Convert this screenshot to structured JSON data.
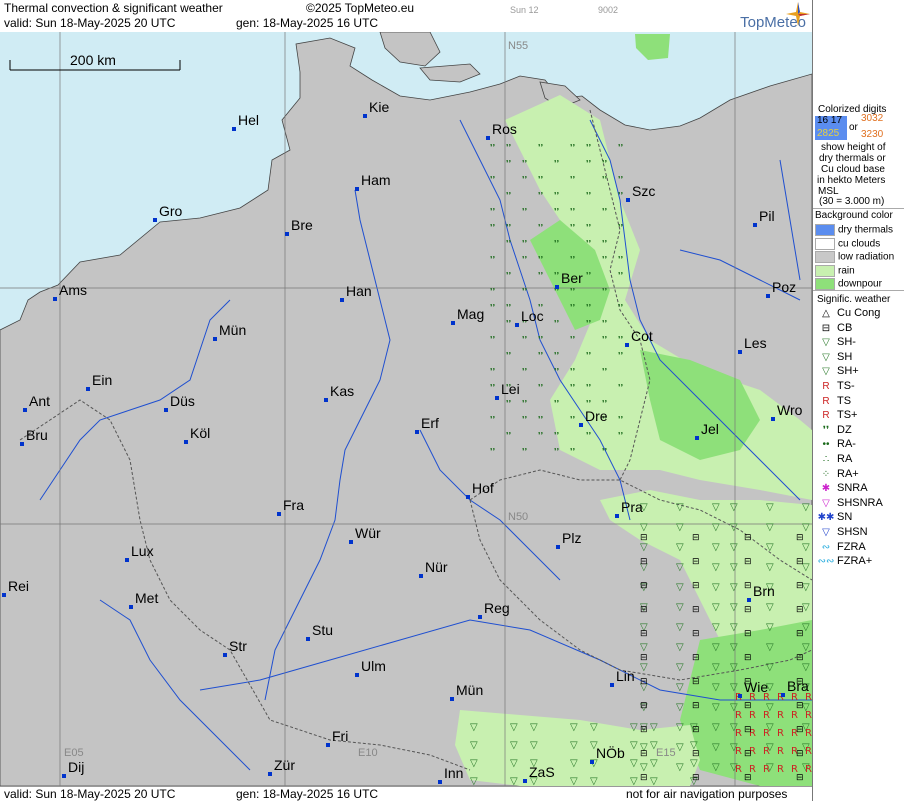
{
  "header": {
    "title": "Thermal convection & significant weather",
    "copyright": "©2025 TopMeteo.eu",
    "tag1": "Sun 12",
    "tag2": "9002",
    "valid": "valid:  Sun  18-May-2025  20 UTC",
    "gen": "gen: 18-May-2025 16 UTC",
    "logo": "TopMeteo"
  },
  "footer": {
    "valid": "valid:  Sun  18-May-2025  20 UTC",
    "gen": "gen: 18-May-2025 16 UTC",
    "note": "not for air navigation purposes"
  },
  "map": {
    "scale_label": "200 km",
    "coord_labels": [
      "N55",
      "N50",
      "E05",
      "E10",
      "E15"
    ],
    "cities": [
      "Kie",
      "Hel",
      "Ros",
      "Ham",
      "Gro",
      "Szc",
      "Bre",
      "Pil",
      "Ber",
      "Ams",
      "Han",
      "Poz",
      "Mag",
      "Loc",
      "Mün",
      "Cot",
      "Les",
      "Ein",
      "Kas",
      "Lei",
      "Ant",
      "Düs",
      "Wro",
      "Bru",
      "Köl",
      "Erf",
      "Dre",
      "Jel",
      "Hof",
      "Fra",
      "Pra",
      "Wür",
      "Lux",
      "Plz",
      "Nür",
      "Rei",
      "Met",
      "Brn",
      "Reg",
      "Stu",
      "Str",
      "Lin",
      "Ulm",
      "Wie",
      "Bra",
      "Mün",
      "Fri",
      "NÖb",
      "Dij",
      "Zür",
      "Inn",
      "ZaS"
    ]
  },
  "legend": {
    "digits_title": "Colorized digits",
    "d1": "16",
    "d2": "17",
    "d3": "30",
    "d4": "32",
    "or": "or",
    "d5": "28",
    "d6": "25",
    "d7": "32",
    "d8": "30",
    "desc": [
      "show height of",
      "dry thermals or",
      "Cu cloud base",
      "in hekto Meters",
      "MSL",
      "(30 = 3.000 m)"
    ],
    "bg_title": "Background color",
    "bg_items": [
      {
        "label": "dry thermals",
        "color": "#5b8def"
      },
      {
        "label": "cu clouds",
        "color": "#ffffff"
      },
      {
        "label": "low radiation",
        "color": "#c8c8c8"
      },
      {
        "label": "rain",
        "color": "#c8f0b0"
      },
      {
        "label": "downpour",
        "color": "#8ee07a"
      }
    ],
    "wx_title": "Signific. weather",
    "wx_items": [
      {
        "label": "Cu Cong",
        "icon": "cu-cong-icon",
        "sym": "△",
        "color": "#000"
      },
      {
        "label": "CB",
        "icon": "cb-icon",
        "sym": "⊟",
        "color": "#000"
      },
      {
        "label": "SH-",
        "icon": "shower-light-icon",
        "sym": "▽",
        "color": "#2a7a2a"
      },
      {
        "label": "SH",
        "icon": "shower-icon",
        "sym": "▽",
        "color": "#2a7a2a"
      },
      {
        "label": "SH+",
        "icon": "shower-heavy-icon",
        "sym": "▽",
        "color": "#2a7a2a"
      },
      {
        "label": "TS-",
        "icon": "thunderstorm-light-icon",
        "sym": "R",
        "color": "#cc2222"
      },
      {
        "label": "TS",
        "icon": "thunderstorm-icon",
        "sym": "R",
        "color": "#cc2222"
      },
      {
        "label": "TS+",
        "icon": "thunderstorm-heavy-icon",
        "sym": "R",
        "color": "#cc2222"
      },
      {
        "label": "DZ",
        "icon": "drizzle-icon",
        "sym": "❜❜",
        "color": "#1a6a1a"
      },
      {
        "label": "RA-",
        "icon": "rain-light-icon",
        "sym": "••",
        "color": "#1a6a1a"
      },
      {
        "label": "RA",
        "icon": "rain-icon",
        "sym": "∴",
        "color": "#1a6a1a"
      },
      {
        "label": "RA+",
        "icon": "rain-heavy-icon",
        "sym": "⁘",
        "color": "#1a6a1a"
      },
      {
        "label": "SNRA",
        "icon": "snow-rain-icon",
        "sym": "✱",
        "color": "#cc22cc"
      },
      {
        "label": "SHSNRA",
        "icon": "shower-snow-rain-icon",
        "sym": "▽",
        "color": "#cc22cc"
      },
      {
        "label": "SN",
        "icon": "snow-icon",
        "sym": "✱✱",
        "color": "#2244cc"
      },
      {
        "label": "SHSN",
        "icon": "shower-snow-icon",
        "sym": "▽",
        "color": "#2244cc"
      },
      {
        "label": "FZRA",
        "icon": "freezing-rain-icon",
        "sym": "∾",
        "color": "#22aadd"
      },
      {
        "label": "FZRA+",
        "icon": "freezing-rain-heavy-icon",
        "sym": "∾∾",
        "color": "#22aadd"
      }
    ]
  }
}
